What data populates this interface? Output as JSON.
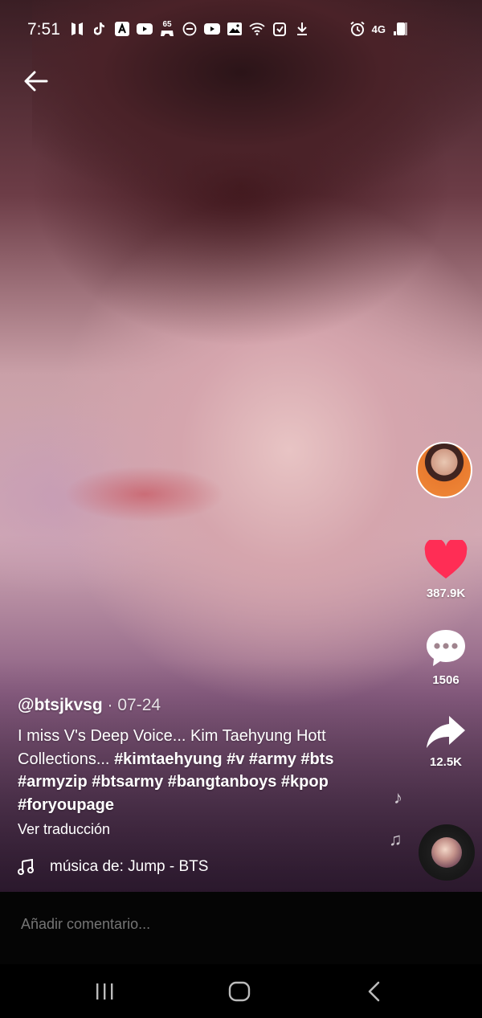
{
  "status_bar": {
    "time": "7:51",
    "notification_icons": [
      "bts-icon",
      "tiktok-icon",
      "adobe-icon",
      "youtube-icon",
      "game-icon",
      "dnd-icon",
      "youtube-icon",
      "gallery-icon",
      "wifi-icon",
      "clipboard-icon",
      "download-icon"
    ],
    "game_badge": "65",
    "network": "4G",
    "right_icons": [
      "alarm-icon",
      "signal-icon",
      "battery-icon"
    ]
  },
  "post": {
    "author": "@btsjkvsg",
    "date": "07-24",
    "caption_text": "I miss V's Deep Voice... Kim Taehyung Hott Collections...",
    "hashtags": [
      "#kimtaehyung",
      "#v",
      "#army",
      "#bts",
      "#armyzip",
      "#btsarmy",
      "#bangtanboys",
      "#kpop",
      "#foryoupage"
    ],
    "translate_label": "Ver traducción",
    "music_label": "música de: Jump - BTS"
  },
  "actions": {
    "likes": "387.9K",
    "comments": "1506",
    "shares": "12.5K"
  },
  "comment_bar": {
    "placeholder": "Añadir comentario..."
  },
  "colors": {
    "like_red": "#ff2d55",
    "comment_bar_bg": "#050505",
    "placeholder_gray": "#6f6f6f"
  }
}
